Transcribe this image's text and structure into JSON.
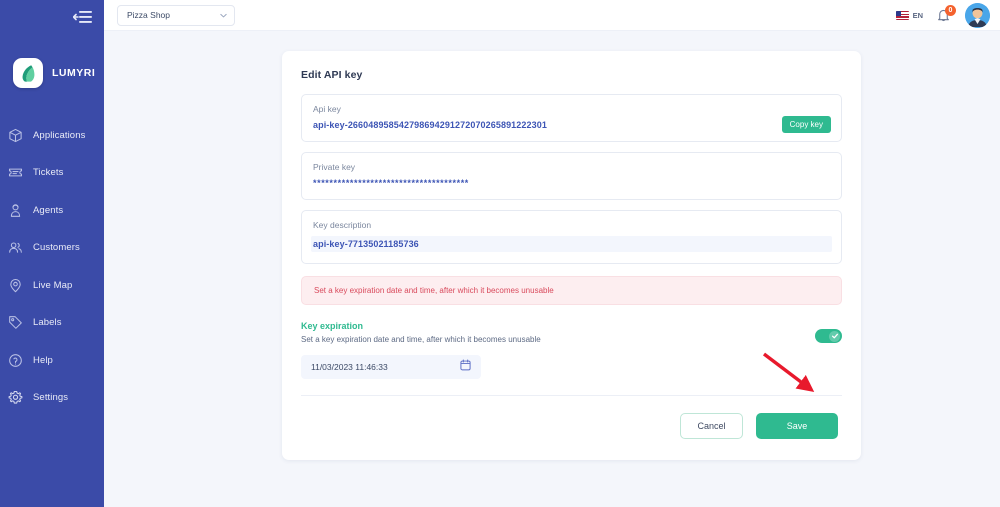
{
  "sidebar": {
    "collapse_icon": "collapse-sidebar-icon",
    "brand": {
      "name": "LUMYRI",
      "logo_icon": "lumyri-leaf-logo-icon"
    },
    "items": [
      {
        "label": "Applications",
        "icon": "box-icon"
      },
      {
        "label": "Tickets",
        "icon": "ticket-icon"
      },
      {
        "label": "Agents",
        "icon": "agent-headset-icon"
      },
      {
        "label": "Customers",
        "icon": "people-icon"
      },
      {
        "label": "Live Map",
        "icon": "map-pin-icon"
      },
      {
        "label": "Labels",
        "icon": "tag-icon"
      },
      {
        "label": "Help",
        "icon": "question-circle-icon"
      },
      {
        "label": "Settings",
        "icon": "gear-icon"
      }
    ]
  },
  "topbar": {
    "shop_selector": {
      "value": "Pizza Shop",
      "icon": "chevron-down-icon"
    },
    "language": {
      "code": "EN",
      "flag_icon": "us-flag-icon"
    },
    "notifications": {
      "count": "0",
      "icon": "bell-icon"
    },
    "avatar_icon": "user-avatar"
  },
  "card": {
    "title": "Edit API key",
    "api_key": {
      "label": "Api key",
      "value": "api-key-266048958542798694291272070265891222301",
      "copy_label": "Copy key"
    },
    "private_key": {
      "label": "Private key",
      "value": "**************************************"
    },
    "key_description": {
      "label": "Key description",
      "value": "api-key-77135021185736"
    },
    "alert": {
      "text": "Set a key expiration date and time, after which it becomes unusable"
    },
    "expiration": {
      "title": "Key expiration",
      "subtitle": "Set a key expiration date and time, after which it becomes unusable",
      "toggle_state": "on",
      "toggle_icon": "check-icon",
      "date_value": "11/03/2023 11:46:33",
      "calendar_icon": "calendar-icon"
    },
    "actions": {
      "cancel_label": "Cancel",
      "save_label": "Save"
    }
  },
  "annotation": {
    "arrow_icon": "red-pointer-arrow",
    "color": "#e8192c"
  },
  "colors": {
    "sidebar": "#3b4ba8",
    "accent_teal": "#2fba90",
    "link_blue": "#3d55b5",
    "alert_red": "#d94a5c",
    "badge_orange": "#f4622e"
  }
}
